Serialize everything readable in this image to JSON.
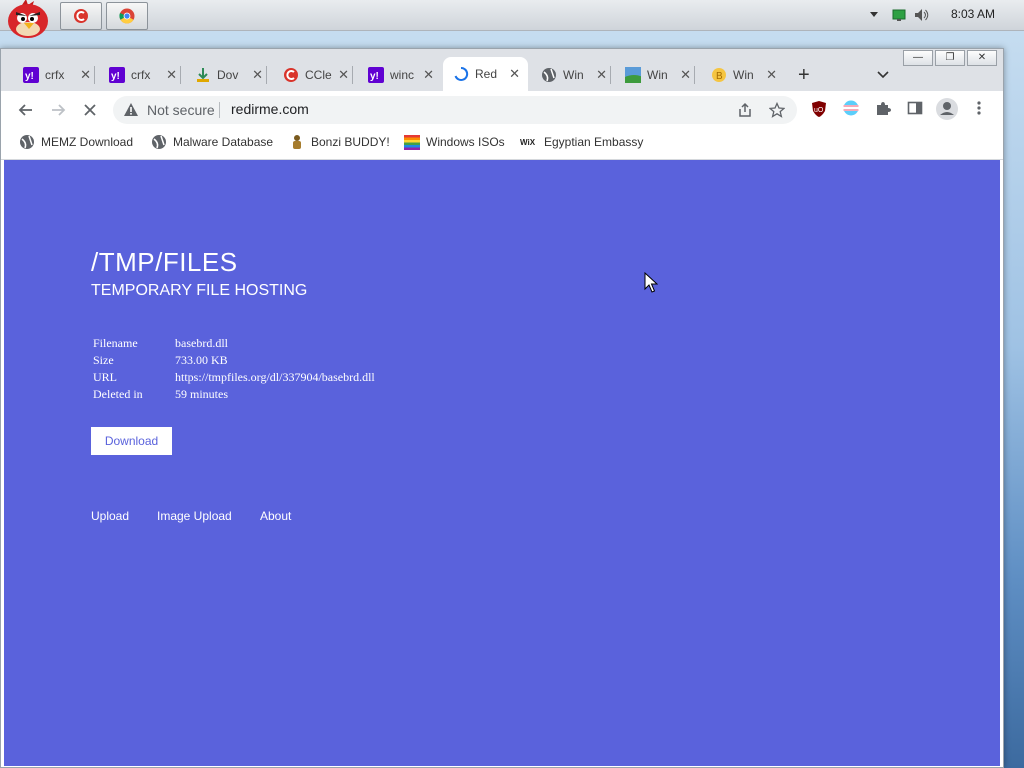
{
  "taskbar": {
    "clock": "8:03 AM",
    "apps": [
      {
        "icon": "ccleaner-icon"
      },
      {
        "icon": "chrome-icon"
      }
    ]
  },
  "browser": {
    "tabs": [
      {
        "label": "crfx",
        "icon": "yahoo-icon"
      },
      {
        "label": "crfx",
        "icon": "yahoo-icon"
      },
      {
        "label": "Dov",
        "icon": "download-icon"
      },
      {
        "label": "CCle",
        "icon": "ccleaner-icon"
      },
      {
        "label": "winc",
        "icon": "yahoo-icon"
      },
      {
        "label": "Red",
        "icon": "loading-spinner-icon",
        "active": true
      },
      {
        "label": "Win",
        "icon": "globe-icon"
      },
      {
        "label": "Win",
        "icon": "landscape-icon"
      },
      {
        "label": "Win",
        "icon": "coin-icon"
      }
    ],
    "omnibox": {
      "security_label": "Not secure",
      "url": "redirme.com"
    },
    "bookmarks": [
      {
        "label": "MEMZ Download",
        "icon": "globe-icon"
      },
      {
        "label": "Malware Database",
        "icon": "globe-icon"
      },
      {
        "label": "Bonzi BUDDY!",
        "icon": "bonzi-icon"
      },
      {
        "label": "Windows ISOs",
        "icon": "windows-flag-icon"
      },
      {
        "label": "Egyptian Embassy",
        "icon": "wix-icon"
      }
    ]
  },
  "page": {
    "title": "/TMP/FILES",
    "subtitle": "TEMPORARY FILE HOSTING",
    "info": [
      {
        "key": "Filename",
        "value": "basebrd.dll"
      },
      {
        "key": "Size",
        "value": "733.00 KB"
      },
      {
        "key": "URL",
        "value": "https://tmpfiles.org/dl/337904/basebrd.dll"
      },
      {
        "key": "Deleted in",
        "value": "59 minutes"
      }
    ],
    "download_label": "Download",
    "footer": [
      "Upload",
      "Image Upload",
      "About"
    ],
    "background_color": "#5a62dc"
  }
}
